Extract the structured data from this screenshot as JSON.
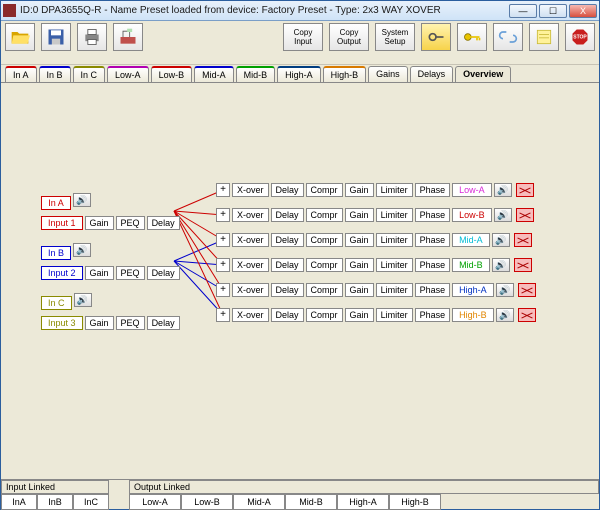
{
  "window": {
    "title": "ID:0 DPA3655Q-R - Name Preset loaded from device: Factory Preset - Type: 2x3 WAY XOVER",
    "min": "—",
    "max": "☐",
    "close": "X"
  },
  "toolbar": {
    "copy_input": "Copy\nInput",
    "copy_output": "Copy\nOutput",
    "system_setup": "System\nSetup"
  },
  "tabs": [
    "In A",
    "In B",
    "In C",
    "Low-A",
    "Low-B",
    "Mid-A",
    "Mid-B",
    "High-A",
    "High-B",
    "Gains",
    "Delays",
    "Overview"
  ],
  "tab_active": 11,
  "tab_colors": [
    "#c00",
    "#00c",
    "#8a8a00",
    "#b100b1",
    "#c00",
    "#00c",
    "#00a000",
    "#003d80",
    "#d87a00",
    "",
    ""
  ],
  "inputs": [
    {
      "name": "In A",
      "src": "Input 1",
      "cls": "red"
    },
    {
      "name": "In B",
      "src": "Input 2",
      "cls": "blue"
    },
    {
      "name": "In C",
      "src": "Input 3",
      "cls": "olive"
    }
  ],
  "in_nodes": [
    "Gain",
    "PEQ",
    "Delay"
  ],
  "outputs": [
    {
      "name": "Low-A",
      "color": "#d829d8"
    },
    {
      "name": "Low-B",
      "color": "#c00"
    },
    {
      "name": "Mid-A",
      "color": "#00bcd4"
    },
    {
      "name": "Mid-B",
      "color": "#00a000"
    },
    {
      "name": "High-A",
      "color": "#0030c0"
    },
    {
      "name": "High-B",
      "color": "#e08500"
    }
  ],
  "out_nodes": [
    "X-over",
    "Delay",
    "Compr",
    "Gain",
    "Limiter",
    "Phase"
  ],
  "footer": {
    "input_linked": "Input Linked",
    "output_linked": "Output Linked",
    "in_cells": [
      "InA",
      "InB",
      "InC"
    ],
    "out_cells": [
      "Low-A",
      "Low-B",
      "Mid-A",
      "Mid-B",
      "High-A",
      "High-B"
    ]
  }
}
